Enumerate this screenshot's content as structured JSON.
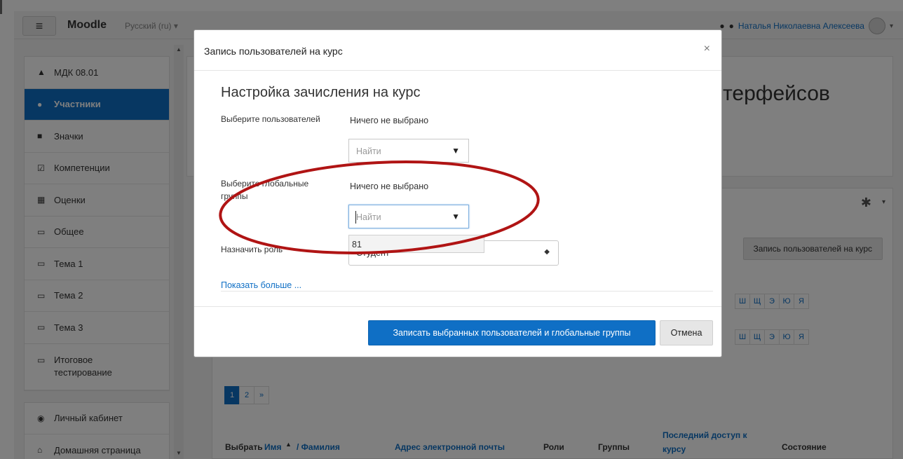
{
  "navbar": {
    "menu_icon": "hamburger-icon",
    "brand": "Moodle",
    "language": "Русский (ru) ▾",
    "user_name": "Наталья Николаевна Алексеева"
  },
  "sidebar": {
    "items": [
      {
        "label": "МДК 08.01",
        "icon": "graduation-cap-icon"
      },
      {
        "label": "Участники",
        "icon": "users-icon"
      },
      {
        "label": "Значки",
        "icon": "shield-icon"
      },
      {
        "label": "Компетенции",
        "icon": "checkbox-icon"
      },
      {
        "label": "Оценки",
        "icon": "table-icon"
      },
      {
        "label": "Общее",
        "icon": "folder-icon"
      },
      {
        "label": "Тема 1",
        "icon": "folder-icon"
      },
      {
        "label": "Тема 2",
        "icon": "folder-icon"
      },
      {
        "label": "Тема 3",
        "icon": "folder-icon"
      },
      {
        "label": "Итоговое тестирование",
        "icon": "folder-icon"
      }
    ],
    "bottom_items": [
      {
        "label": "Личный кабинет",
        "icon": "dashboard-icon"
      },
      {
        "label": "Домашняя страница",
        "icon": "home-icon"
      }
    ]
  },
  "course": {
    "title_fragment": "терфейсов",
    "enrol_button": "Запись пользователей на курс",
    "letters_row1": [
      "Ш",
      "Щ",
      "Э",
      "Ю",
      "Я"
    ],
    "letters_row2": [
      "Ш",
      "Щ",
      "Э",
      "Ю",
      "Я"
    ],
    "pager": [
      "1",
      "2",
      "»"
    ],
    "table_headers": {
      "select": "Выбрать",
      "first_name": "Имя",
      "sort_marker": "▲",
      "last_name": "/ Фамилия",
      "email": "Адрес электронной почты",
      "roles": "Роли",
      "groups": "Группы",
      "last_access": "Последний доступ к курсу",
      "status": "Состояние"
    }
  },
  "modal": {
    "title": "Запись пользователей на курс",
    "close_symbol": "×",
    "form_title": "Настройка зачисления на курс",
    "users_label": "Выберите пользователей",
    "users_value": "Ничего не выбрано",
    "users_placeholder": "Найти",
    "cohorts_label": "Выберите глобальные группы",
    "cohorts_value": "Ничего не выбрано",
    "cohorts_placeholder": "Найти",
    "dropdown_option": "81",
    "role_label": "Назначить роль",
    "role_value": "Студент",
    "show_more": "Показать больше ...",
    "submit": "Записать выбранных пользователей и глобальные группы",
    "cancel": "Отмена"
  },
  "colors": {
    "accent": "#0f6fc5",
    "annotation": "#b01414"
  }
}
